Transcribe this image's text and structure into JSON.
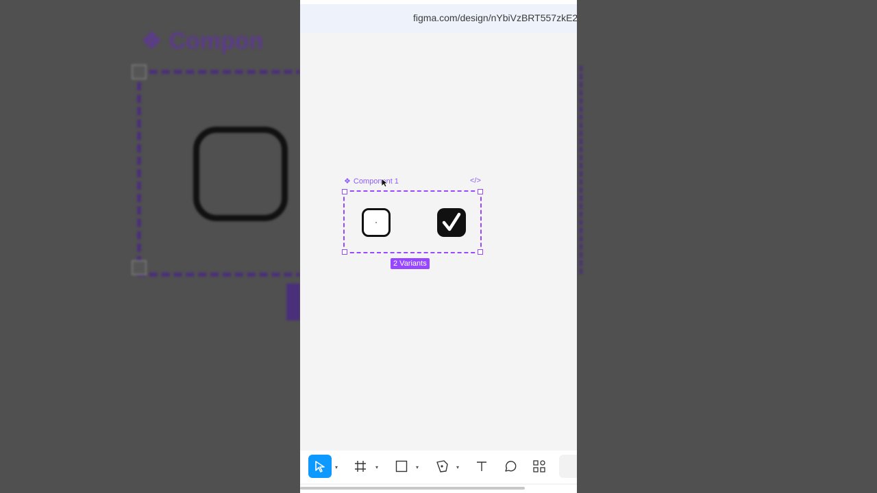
{
  "browser": {
    "url": "figma.com/design/nYbiVzBRT557zkE2"
  },
  "backdrop": {
    "title": "Compon"
  },
  "canvas": {
    "component_name": "Component 1",
    "component_icon": "component-icon",
    "code_icon_glyph": "</>",
    "variants_badge": "2 Variants",
    "variants": [
      {
        "name": "unchecked",
        "state": "unchecked"
      },
      {
        "name": "checked",
        "state": "checked"
      }
    ],
    "accent_color": "#9747ff"
  },
  "toolbar": {
    "tools": [
      {
        "name": "move-tool",
        "icon": "cursor-arrow-icon",
        "active": true,
        "has_menu": true
      },
      {
        "name": "frame-tool",
        "icon": "hash-frame-icon",
        "active": false,
        "has_menu": true
      },
      {
        "name": "shape-tool",
        "icon": "rectangle-icon",
        "active": false,
        "has_menu": true
      },
      {
        "name": "pen-tool",
        "icon": "pen-icon",
        "active": false,
        "has_menu": true
      },
      {
        "name": "text-tool",
        "icon": "text-icon",
        "active": false,
        "has_menu": false
      },
      {
        "name": "comment-tool",
        "icon": "comment-icon",
        "active": false,
        "has_menu": false
      },
      {
        "name": "resources-tool",
        "icon": "resources-icon",
        "active": false,
        "has_menu": false
      }
    ],
    "active_color": "#0d99ff"
  }
}
